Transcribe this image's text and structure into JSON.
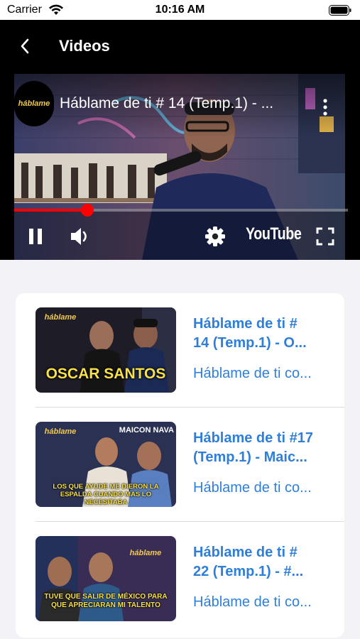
{
  "status_bar": {
    "carrier": "Carrier",
    "time": "10:16 AM"
  },
  "nav": {
    "title": "Videos"
  },
  "player": {
    "title": "Háblame de ti # 14 (Temp.1) - ...",
    "channel_logo_text": "háblame",
    "brand_text": "YouTube",
    "progress_fraction": 0.22
  },
  "videos": [
    {
      "title_line1": "Háblame de ti #",
      "title_line2": "14 (Temp.1) - O...",
      "subtitle": "Háblame de ti co...",
      "thumb_logo": "háblame",
      "thumb_caption": "OSCAR SANTOS"
    },
    {
      "title_line1": "Háblame de ti #17",
      "title_line2": "(Temp.1) - Maic...",
      "subtitle": "Háblame de ti co...",
      "thumb_logo": "háblame",
      "thumb_header": "MAICON NAVA",
      "thumb_caption": "LOS QUE AYUDE ME DIERON LA ESPALDA CUANDO MAS LO NECESITABA"
    },
    {
      "title_line1": "Háblame de ti #",
      "title_line2": "22 (Temp.1) - #...",
      "subtitle": "Háblame de ti co...",
      "thumb_logo": "háblame",
      "thumb_caption": "TUVE QUE SALIR DE MÉXICO PARA QUE APRECIARAN MI TALENTO"
    }
  ],
  "colors": {
    "accent": "#2f7fd8",
    "progress": "#ff0000",
    "caption_yellow": "#f7e04a"
  }
}
